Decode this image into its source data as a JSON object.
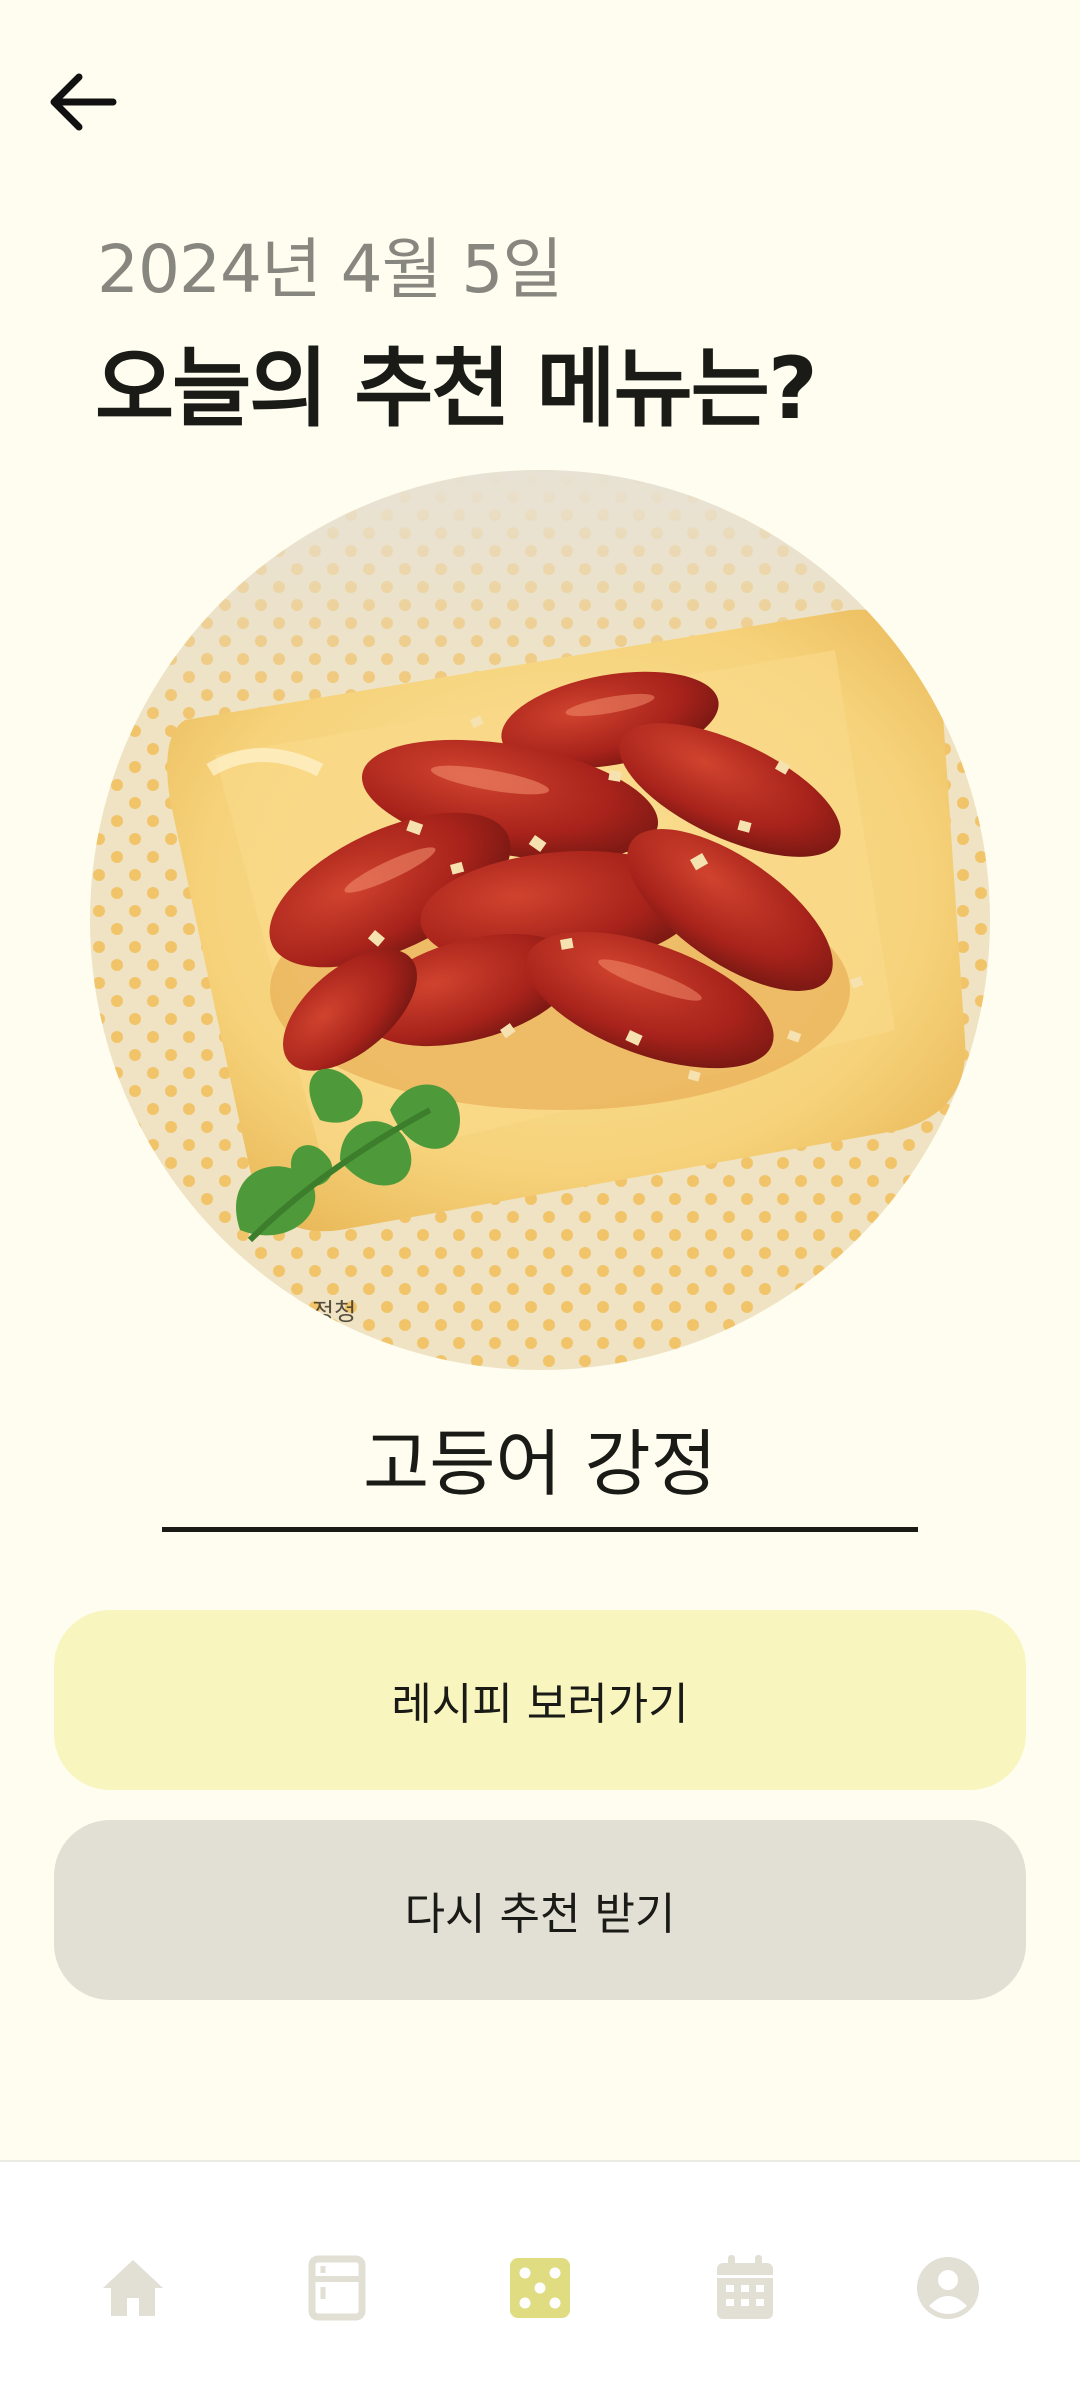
{
  "header": {
    "date": "2024년 4월 5일",
    "title": "오늘의 추천 메뉴는?"
  },
  "recommendation": {
    "menu_name": "고등어 강정",
    "watermark": "정청"
  },
  "actions": {
    "recipe_label": "레시피 보러가기",
    "retry_label": "다시 추천 받기"
  },
  "bottom_nav": {
    "active": "dice",
    "items": [
      "home-icon",
      "fridge-icon",
      "dice-icon",
      "calendar-icon",
      "profile-icon"
    ]
  },
  "colors": {
    "background": "#FEFDF0",
    "accent": "#E0DC82",
    "nav_inactive": "#E2E0D4",
    "recipe_button": "#F8F5BE",
    "retry_button": "#E2E0D4"
  }
}
